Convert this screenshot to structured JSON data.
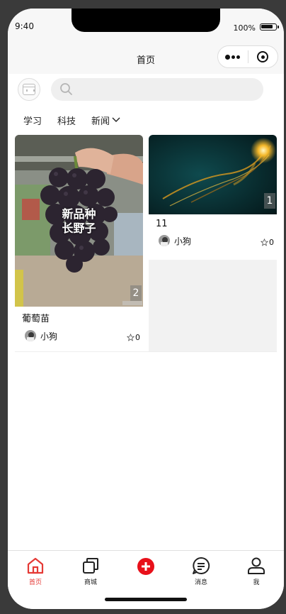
{
  "status_bar": {
    "time": "9:40",
    "battery": "100%"
  },
  "navbar": {
    "title": "首页",
    "capsule_icons": [
      "more-icon",
      "close-target-icon"
    ]
  },
  "search": {
    "placeholder": ""
  },
  "tabs": [
    {
      "label": "学习"
    },
    {
      "label": "科技"
    },
    {
      "label": "新闻",
      "has_dropdown": true
    }
  ],
  "posts": [
    {
      "title": "葡萄苗",
      "image_overlay_text_line1": "新品种",
      "image_overlay_text_line2": "长野子",
      "image_count": "2",
      "author": "小狗",
      "likes": "0"
    },
    {
      "title": "11",
      "image_count": "1",
      "author": "小狗",
      "likes": "0"
    }
  ],
  "tabbar": {
    "items": [
      {
        "label": "首页",
        "icon": "home-icon",
        "active": true
      },
      {
        "label": "商城",
        "icon": "store-icon",
        "active": false
      },
      {
        "label": "",
        "icon": "add-icon",
        "active": false
      },
      {
        "label": "消息",
        "icon": "message-icon",
        "active": false
      },
      {
        "label": "我",
        "icon": "user-icon",
        "active": false
      }
    ]
  },
  "colors": {
    "accent": "#e53935",
    "background": "#ffffff",
    "placeholder_card": "#f2f2f2"
  }
}
